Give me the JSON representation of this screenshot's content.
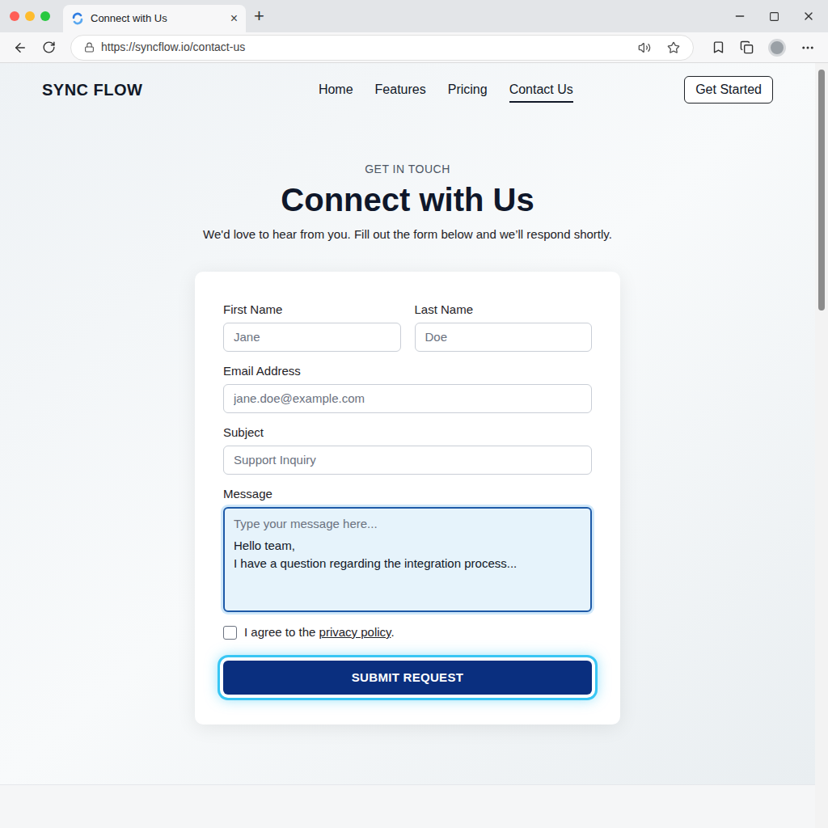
{
  "browser": {
    "tab": {
      "title": "Connect with Us",
      "close": "×"
    },
    "new_tab": "+",
    "url": "https://syncflow.io/contact-us"
  },
  "nav": {
    "logo": "SYNC FLOW",
    "links": [
      {
        "label": "Home",
        "selected": false
      },
      {
        "label": "Features",
        "selected": false
      },
      {
        "label": "Pricing",
        "selected": false
      },
      {
        "label": "Contact Us",
        "selected": true
      }
    ],
    "cta": "Get Started"
  },
  "hero": {
    "eyebrow": "GET IN TOUCH",
    "title": "Connect with Us",
    "subtitle": "We'd love to hear from you. Fill out the form below and we’ll respond shortly."
  },
  "form": {
    "first_name": {
      "label": "First Name",
      "placeholder": "Jane"
    },
    "last_name": {
      "label": "Last Name",
      "placeholder": "Doe"
    },
    "email": {
      "label": "Email Address",
      "placeholder": "jane.doe@example.com"
    },
    "subject": {
      "label": "Subject",
      "placeholder": "Support Inquiry"
    },
    "message": {
      "label": "Message",
      "placeholder": "Type your message here...",
      "value": "Hello team,\nI have a question regarding the integration process...",
      "focused": true
    },
    "consent": {
      "text_before": "I agree to the ",
      "link": "privacy policy",
      "text_after": ".",
      "checked": false
    },
    "submit": {
      "label": "SUBMIT REQUEST",
      "focused": true
    }
  },
  "scrollbar": {
    "level": 0.32
  }
}
